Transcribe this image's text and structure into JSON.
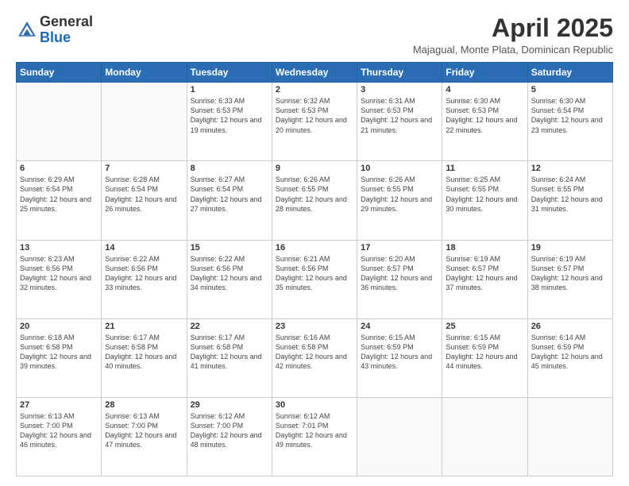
{
  "header": {
    "logo_general": "General",
    "logo_blue": "Blue",
    "month_year": "April 2025",
    "location": "Majagual, Monte Plata, Dominican Republic"
  },
  "days_of_week": [
    "Sunday",
    "Monday",
    "Tuesday",
    "Wednesday",
    "Thursday",
    "Friday",
    "Saturday"
  ],
  "weeks": [
    [
      {
        "day": "",
        "info": ""
      },
      {
        "day": "",
        "info": ""
      },
      {
        "day": "1",
        "info": "Sunrise: 6:33 AM\nSunset: 6:53 PM\nDaylight: 12 hours and 19 minutes."
      },
      {
        "day": "2",
        "info": "Sunrise: 6:32 AM\nSunset: 6:53 PM\nDaylight: 12 hours and 20 minutes."
      },
      {
        "day": "3",
        "info": "Sunrise: 6:31 AM\nSunset: 6:53 PM\nDaylight: 12 hours and 21 minutes."
      },
      {
        "day": "4",
        "info": "Sunrise: 6:30 AM\nSunset: 6:53 PM\nDaylight: 12 hours and 22 minutes."
      },
      {
        "day": "5",
        "info": "Sunrise: 6:30 AM\nSunset: 6:54 PM\nDaylight: 12 hours and 23 minutes."
      }
    ],
    [
      {
        "day": "6",
        "info": "Sunrise: 6:29 AM\nSunset: 6:54 PM\nDaylight: 12 hours and 25 minutes."
      },
      {
        "day": "7",
        "info": "Sunrise: 6:28 AM\nSunset: 6:54 PM\nDaylight: 12 hours and 26 minutes."
      },
      {
        "day": "8",
        "info": "Sunrise: 6:27 AM\nSunset: 6:54 PM\nDaylight: 12 hours and 27 minutes."
      },
      {
        "day": "9",
        "info": "Sunrise: 6:26 AM\nSunset: 6:55 PM\nDaylight: 12 hours and 28 minutes."
      },
      {
        "day": "10",
        "info": "Sunrise: 6:26 AM\nSunset: 6:55 PM\nDaylight: 12 hours and 29 minutes."
      },
      {
        "day": "11",
        "info": "Sunrise: 6:25 AM\nSunset: 6:55 PM\nDaylight: 12 hours and 30 minutes."
      },
      {
        "day": "12",
        "info": "Sunrise: 6:24 AM\nSunset: 6:55 PM\nDaylight: 12 hours and 31 minutes."
      }
    ],
    [
      {
        "day": "13",
        "info": "Sunrise: 6:23 AM\nSunset: 6:56 PM\nDaylight: 12 hours and 32 minutes."
      },
      {
        "day": "14",
        "info": "Sunrise: 6:22 AM\nSunset: 6:56 PM\nDaylight: 12 hours and 33 minutes."
      },
      {
        "day": "15",
        "info": "Sunrise: 6:22 AM\nSunset: 6:56 PM\nDaylight: 12 hours and 34 minutes."
      },
      {
        "day": "16",
        "info": "Sunrise: 6:21 AM\nSunset: 6:56 PM\nDaylight: 12 hours and 35 minutes."
      },
      {
        "day": "17",
        "info": "Sunrise: 6:20 AM\nSunset: 6:57 PM\nDaylight: 12 hours and 36 minutes."
      },
      {
        "day": "18",
        "info": "Sunrise: 6:19 AM\nSunset: 6:57 PM\nDaylight: 12 hours and 37 minutes."
      },
      {
        "day": "19",
        "info": "Sunrise: 6:19 AM\nSunset: 6:57 PM\nDaylight: 12 hours and 38 minutes."
      }
    ],
    [
      {
        "day": "20",
        "info": "Sunrise: 6:18 AM\nSunset: 6:58 PM\nDaylight: 12 hours and 39 minutes."
      },
      {
        "day": "21",
        "info": "Sunrise: 6:17 AM\nSunset: 6:58 PM\nDaylight: 12 hours and 40 minutes."
      },
      {
        "day": "22",
        "info": "Sunrise: 6:17 AM\nSunset: 6:58 PM\nDaylight: 12 hours and 41 minutes."
      },
      {
        "day": "23",
        "info": "Sunrise: 6:16 AM\nSunset: 6:58 PM\nDaylight: 12 hours and 42 minutes."
      },
      {
        "day": "24",
        "info": "Sunrise: 6:15 AM\nSunset: 6:59 PM\nDaylight: 12 hours and 43 minutes."
      },
      {
        "day": "25",
        "info": "Sunrise: 6:15 AM\nSunset: 6:59 PM\nDaylight: 12 hours and 44 minutes."
      },
      {
        "day": "26",
        "info": "Sunrise: 6:14 AM\nSunset: 6:59 PM\nDaylight: 12 hours and 45 minutes."
      }
    ],
    [
      {
        "day": "27",
        "info": "Sunrise: 6:13 AM\nSunset: 7:00 PM\nDaylight: 12 hours and 46 minutes."
      },
      {
        "day": "28",
        "info": "Sunrise: 6:13 AM\nSunset: 7:00 PM\nDaylight: 12 hours and 47 minutes."
      },
      {
        "day": "29",
        "info": "Sunrise: 6:12 AM\nSunset: 7:00 PM\nDaylight: 12 hours and 48 minutes."
      },
      {
        "day": "30",
        "info": "Sunrise: 6:12 AM\nSunset: 7:01 PM\nDaylight: 12 hours and 49 minutes."
      },
      {
        "day": "",
        "info": ""
      },
      {
        "day": "",
        "info": ""
      },
      {
        "day": "",
        "info": ""
      }
    ]
  ]
}
